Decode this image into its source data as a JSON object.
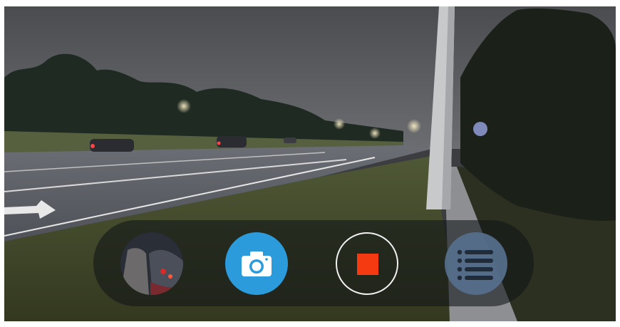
{
  "view": {
    "scene_description_icon": "live-camera-feed-icon"
  },
  "controls": {
    "gallery_icon": "gallery-thumbnail-icon",
    "camera_icon": "camera-icon",
    "record_icon": "stop-record-icon",
    "menu_icon": "list-menu-icon",
    "colors": {
      "camera_button": "#2b9bdc",
      "stop_square": "#f53a12",
      "menu_button": "#566f8c",
      "bar_background": "#121416"
    }
  }
}
